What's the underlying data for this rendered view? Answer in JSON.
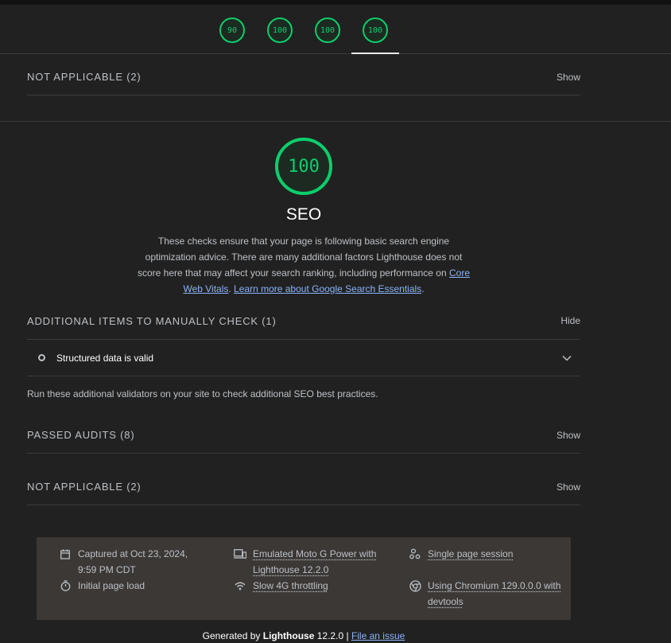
{
  "header": {
    "scores": [
      "90",
      "100",
      "100",
      "100"
    ]
  },
  "groups": {
    "top_not_applicable": {
      "title": "NOT APPLICABLE (2)",
      "toggle": "Show"
    },
    "manual": {
      "title": "ADDITIONAL ITEMS TO MANUALLY CHECK (1)",
      "toggle": "Hide"
    },
    "passed": {
      "title": "PASSED AUDITS (8)",
      "toggle": "Show"
    },
    "not_applicable": {
      "title": "NOT APPLICABLE (2)",
      "toggle": "Show"
    }
  },
  "category": {
    "score": "100",
    "title": "SEO",
    "desc_text": "These checks ensure that your page is following basic search engine optimization advice. There are many additional factors Lighthouse does not score here that may affect your search ranking, including performance on ",
    "link_cwv": "Core Web Vitals",
    "sep": ". ",
    "link_essentials": "Learn more about Google Search Essentials",
    "end": "."
  },
  "manual_audit": {
    "title": "Structured data is valid",
    "description": "Run these additional validators on your site to check additional SEO best practices."
  },
  "environment": {
    "captured": "Captured at Oct 23, 2024, 9:59 PM CDT",
    "page_load": "Initial page load",
    "device": "Emulated Moto G Power with Lighthouse 12.2.0",
    "throttling": "Slow 4G throttling",
    "session": "Single page session",
    "browser": "Using Chromium 129.0.0.0 with devtools"
  },
  "footer": {
    "generated_by": "Generated by",
    "product": "Lighthouse",
    "version": "12.2.0",
    "sep": "|",
    "file_issue": "File an issue"
  },
  "colors": {
    "pass": "#0cce6b",
    "background": "#212121",
    "link": "#8ab4f8",
    "footer_box": "#3b3836"
  }
}
